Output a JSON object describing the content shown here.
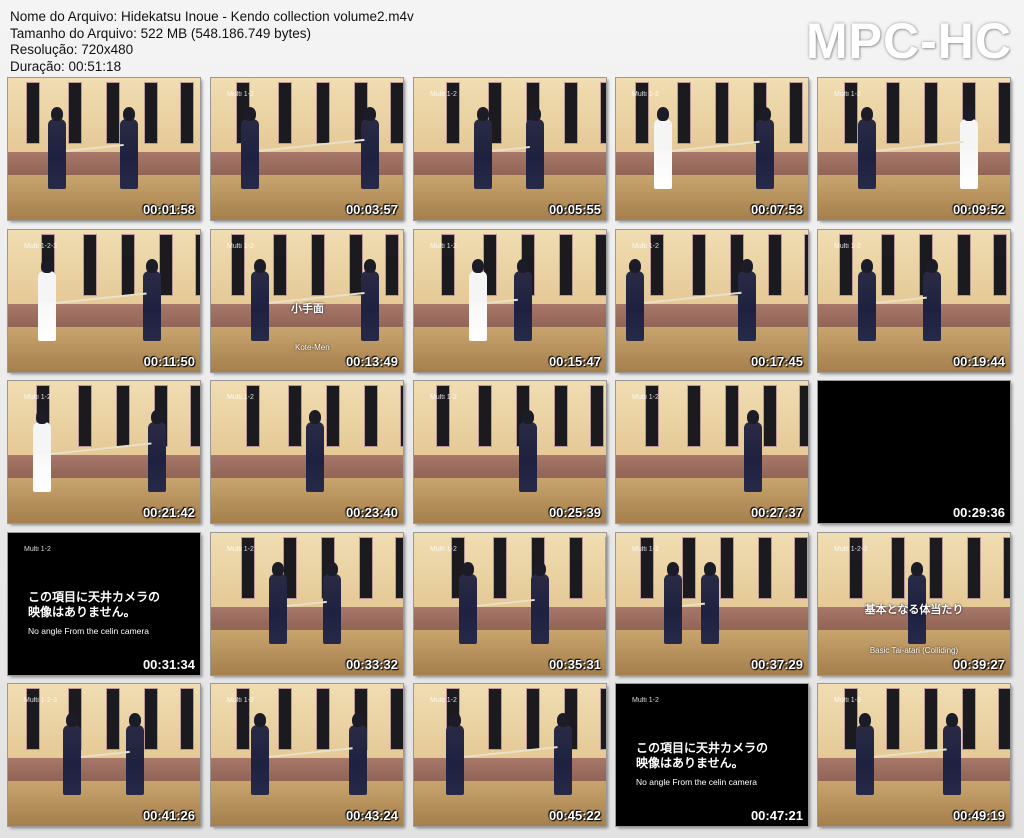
{
  "info": {
    "filename": "Nome do Arquivo: Hidekatsu Inoue - Kendo collection volume2.m4v",
    "filesize": "Tamanho do Arquivo: 522 MB (548.186.749 bytes)",
    "resolution": "Resolução: 720x480",
    "duration": "Duração: 00:51:18"
  },
  "brand": "MPC-HC",
  "thumbnails": [
    {
      "time": "00:01:58",
      "label": "",
      "dark": false
    },
    {
      "time": "00:03:57",
      "label": "Multi 1-2",
      "dark": false
    },
    {
      "time": "00:05:55",
      "label": "Multi 1-2",
      "dark": false
    },
    {
      "time": "00:07:53",
      "label": "Multi 1-2",
      "dark": false
    },
    {
      "time": "00:09:52",
      "label": "Multi 1-2",
      "dark": false
    },
    {
      "time": "00:11:50",
      "label": "Multi 1-2-3",
      "dark": false
    },
    {
      "time": "00:13:49",
      "label": "Multi 1-2",
      "dark": false,
      "caption": "小手面",
      "subtitle": "Kote-Men"
    },
    {
      "time": "00:15:47",
      "label": "Multi 1-2",
      "dark": false
    },
    {
      "time": "00:17:45",
      "label": "Multi 1-2",
      "dark": false
    },
    {
      "time": "00:19:44",
      "label": "Multi 1-2",
      "dark": false
    },
    {
      "time": "00:21:42",
      "label": "Multi 1-2",
      "dark": false
    },
    {
      "time": "00:23:40",
      "label": "Multi 1-2",
      "dark": false
    },
    {
      "time": "00:25:39",
      "label": "Multi 1-2",
      "dark": false
    },
    {
      "time": "00:27:37",
      "label": "Multi 1-2",
      "dark": false
    },
    {
      "time": "00:29:36",
      "label": "",
      "dark": true
    },
    {
      "time": "00:31:34",
      "label": "Multi 1-2",
      "dark": true,
      "message": [
        "この項目に天井カメラの",
        "映像はありません。",
        "No angle From the celin camera"
      ]
    },
    {
      "time": "00:33:32",
      "label": "Multi 1-2",
      "dark": false
    },
    {
      "time": "00:35:31",
      "label": "Multi 1-2",
      "dark": false
    },
    {
      "time": "00:37:29",
      "label": "Multi 1-2",
      "dark": false
    },
    {
      "time": "00:39:27",
      "label": "Multi 1-2-3",
      "dark": false,
      "caption": "基本となる体当たり",
      "subtitle": "Basic Tai-atari (Colliding)"
    },
    {
      "time": "00:41:26",
      "label": "Multi 1-2-3",
      "dark": false
    },
    {
      "time": "00:43:24",
      "label": "Multi 1-2",
      "dark": false
    },
    {
      "time": "00:45:22",
      "label": "Multi 1-2",
      "dark": false
    },
    {
      "time": "00:47:21",
      "label": "Multi 1-2",
      "dark": true,
      "message": [
        "この項目に天井カメラの",
        "映像はありません。",
        "No angle From the celin camera"
      ]
    },
    {
      "time": "00:49:19",
      "label": "Multi 1-3",
      "dark": false
    }
  ]
}
